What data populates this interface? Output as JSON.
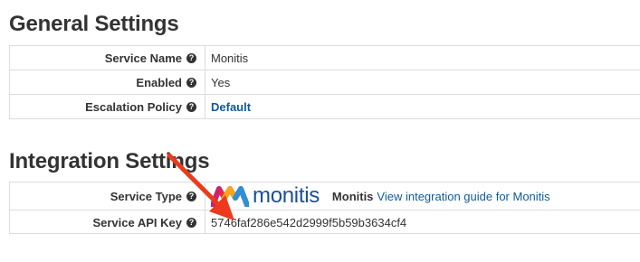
{
  "general": {
    "title": "General Settings",
    "rows": [
      {
        "label": "Service Name",
        "value": "Monitis"
      },
      {
        "label": "Enabled",
        "value": "Yes"
      },
      {
        "label": "Escalation Policy",
        "value": "Default"
      }
    ]
  },
  "integration": {
    "title": "Integration Settings",
    "service_type": {
      "label": "Service Type",
      "logo_text": "monitis",
      "name": "Monitis",
      "guide_link": "View integration guide for Monitis"
    },
    "api_key": {
      "label": "Service API Key",
      "value": "5746faf286e542d2999f5b59b3634cf4"
    }
  },
  "icons": {
    "help": "?"
  },
  "colors": {
    "link": "#0f5a9c",
    "arrow": "#ee3a1c",
    "border": "#dddddd"
  }
}
